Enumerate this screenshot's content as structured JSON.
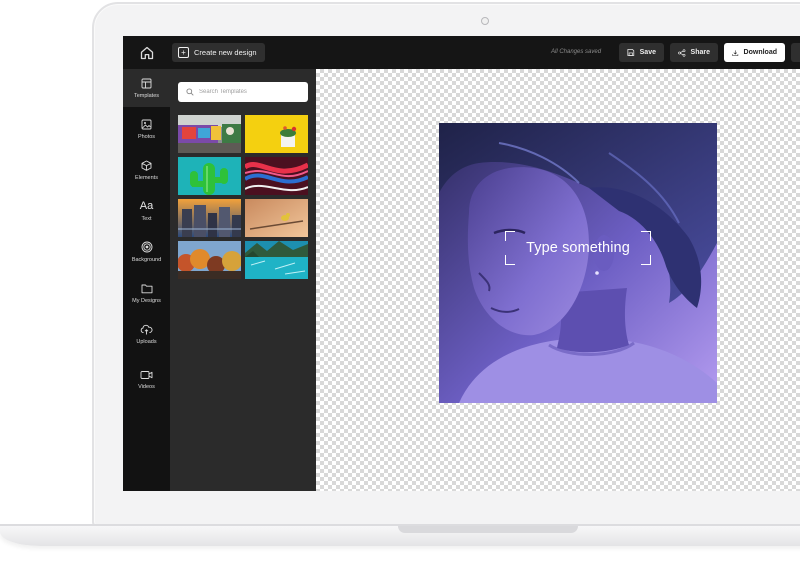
{
  "header": {
    "create_label": "Create new design",
    "saved_status": "All Changes saved",
    "save_label": "Save",
    "share_label": "Share",
    "download_label": "Download"
  },
  "rail": {
    "items": [
      {
        "label": "Templates",
        "icon": "templates-icon",
        "active": true
      },
      {
        "label": "Photos",
        "icon": "photo-icon"
      },
      {
        "label": "Elements",
        "icon": "cube-icon"
      },
      {
        "label": "Text",
        "icon": "text-aa-icon",
        "glyph": "Aa"
      },
      {
        "label": "Background",
        "icon": "target-icon"
      },
      {
        "label": "My Designs",
        "icon": "folder-icon"
      },
      {
        "label": "Uploads",
        "icon": "cloud-upload-icon"
      },
      {
        "label": "Videos",
        "icon": "video-camera-icon"
      }
    ]
  },
  "panel": {
    "search_placeholder": "Search Templates",
    "thumbnails": [
      "graffiti street scene",
      "yellow background with plant pot",
      "inflatable green cactus on teal",
      "red and blue abstract swirls",
      "city skyline at dusk",
      "bird on branch at sunset",
      "autumn trees and sky",
      "turquoise lake with mountains"
    ]
  },
  "canvas": {
    "text_element": "Type something",
    "background": "checkerboard-transparent",
    "artboard_image": "portrait of woman in purple light"
  },
  "colors": {
    "topbar": "#151515",
    "rail": "#121212",
    "panel": "#2b2b2b",
    "button": "#2f2f2f",
    "download_button": "#ffffff",
    "artboard_tint": "#7a72d0"
  }
}
